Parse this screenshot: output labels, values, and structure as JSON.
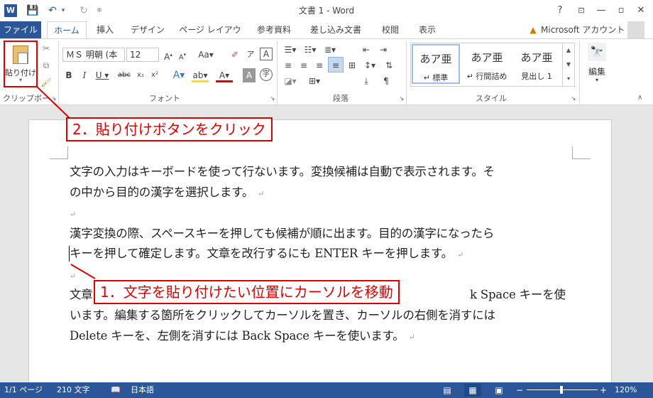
{
  "titlebar": {
    "app_icon": "W",
    "title": "文書 1 - Word",
    "help": "?",
    "minimize": "—",
    "restore": "▫",
    "close": "✕"
  },
  "tabs": [
    {
      "label": "ファイル"
    },
    {
      "label": "ホーム"
    },
    {
      "label": "挿入"
    },
    {
      "label": "デザイン"
    },
    {
      "label": "ページ レイアウト"
    },
    {
      "label": "参考資料"
    },
    {
      "label": "差し込み文書"
    },
    {
      "label": "校閲"
    },
    {
      "label": "表示"
    }
  ],
  "account": "Microsoft アカウント",
  "ribbon": {
    "clipboard": {
      "paste_label": "貼り付け",
      "group_label": "クリップボード"
    },
    "font": {
      "name": "ＭＳ 明朝 (本",
      "size": "12",
      "group_label": "フォント"
    },
    "paragraph": {
      "group_label": "段落"
    },
    "styles": {
      "group_label": "スタイル",
      "items": [
        {
          "sample": "あア亜",
          "name": "↵ 標準"
        },
        {
          "sample": "あア亜",
          "name": "↵ 行間詰め"
        },
        {
          "sample": "あア亜",
          "name": "見出し 1"
        }
      ]
    },
    "edit": {
      "label": "編集"
    }
  },
  "document": {
    "para1_line1": "文字の入力はキーボードを使って行ないます。変換候補は自動で表示されます。そ",
    "para1_line2": "の中から目的の漢字を選択します。",
    "para2_line1": "漢字変換の際、スペースキーを押しても候補が順に出ます。目的の漢字になったら",
    "para2_line2": "キーを押して確定します。文章を改行するにも ENTER キーを押します。",
    "para3_line1_a": "文章",
    "para3_line1_b": "k Space キーを使",
    "para3_line2": "います。編集する箇所をクリックしてカーソルを置き、カーソルの右側を消すには",
    "para3_line3": "Delete キーを、左側を消すには Back Space キーを使います。",
    "para_mark": "↵"
  },
  "callouts": {
    "step2": "2．貼り付けボタンをクリック",
    "step1": "1．文字を貼り付けたい位置にカーソルを移動"
  },
  "status": {
    "page": "1/1 ページ",
    "words": "210 文字",
    "language": "日本語",
    "zoom": "120%",
    "minus": "−",
    "plus": "+"
  }
}
